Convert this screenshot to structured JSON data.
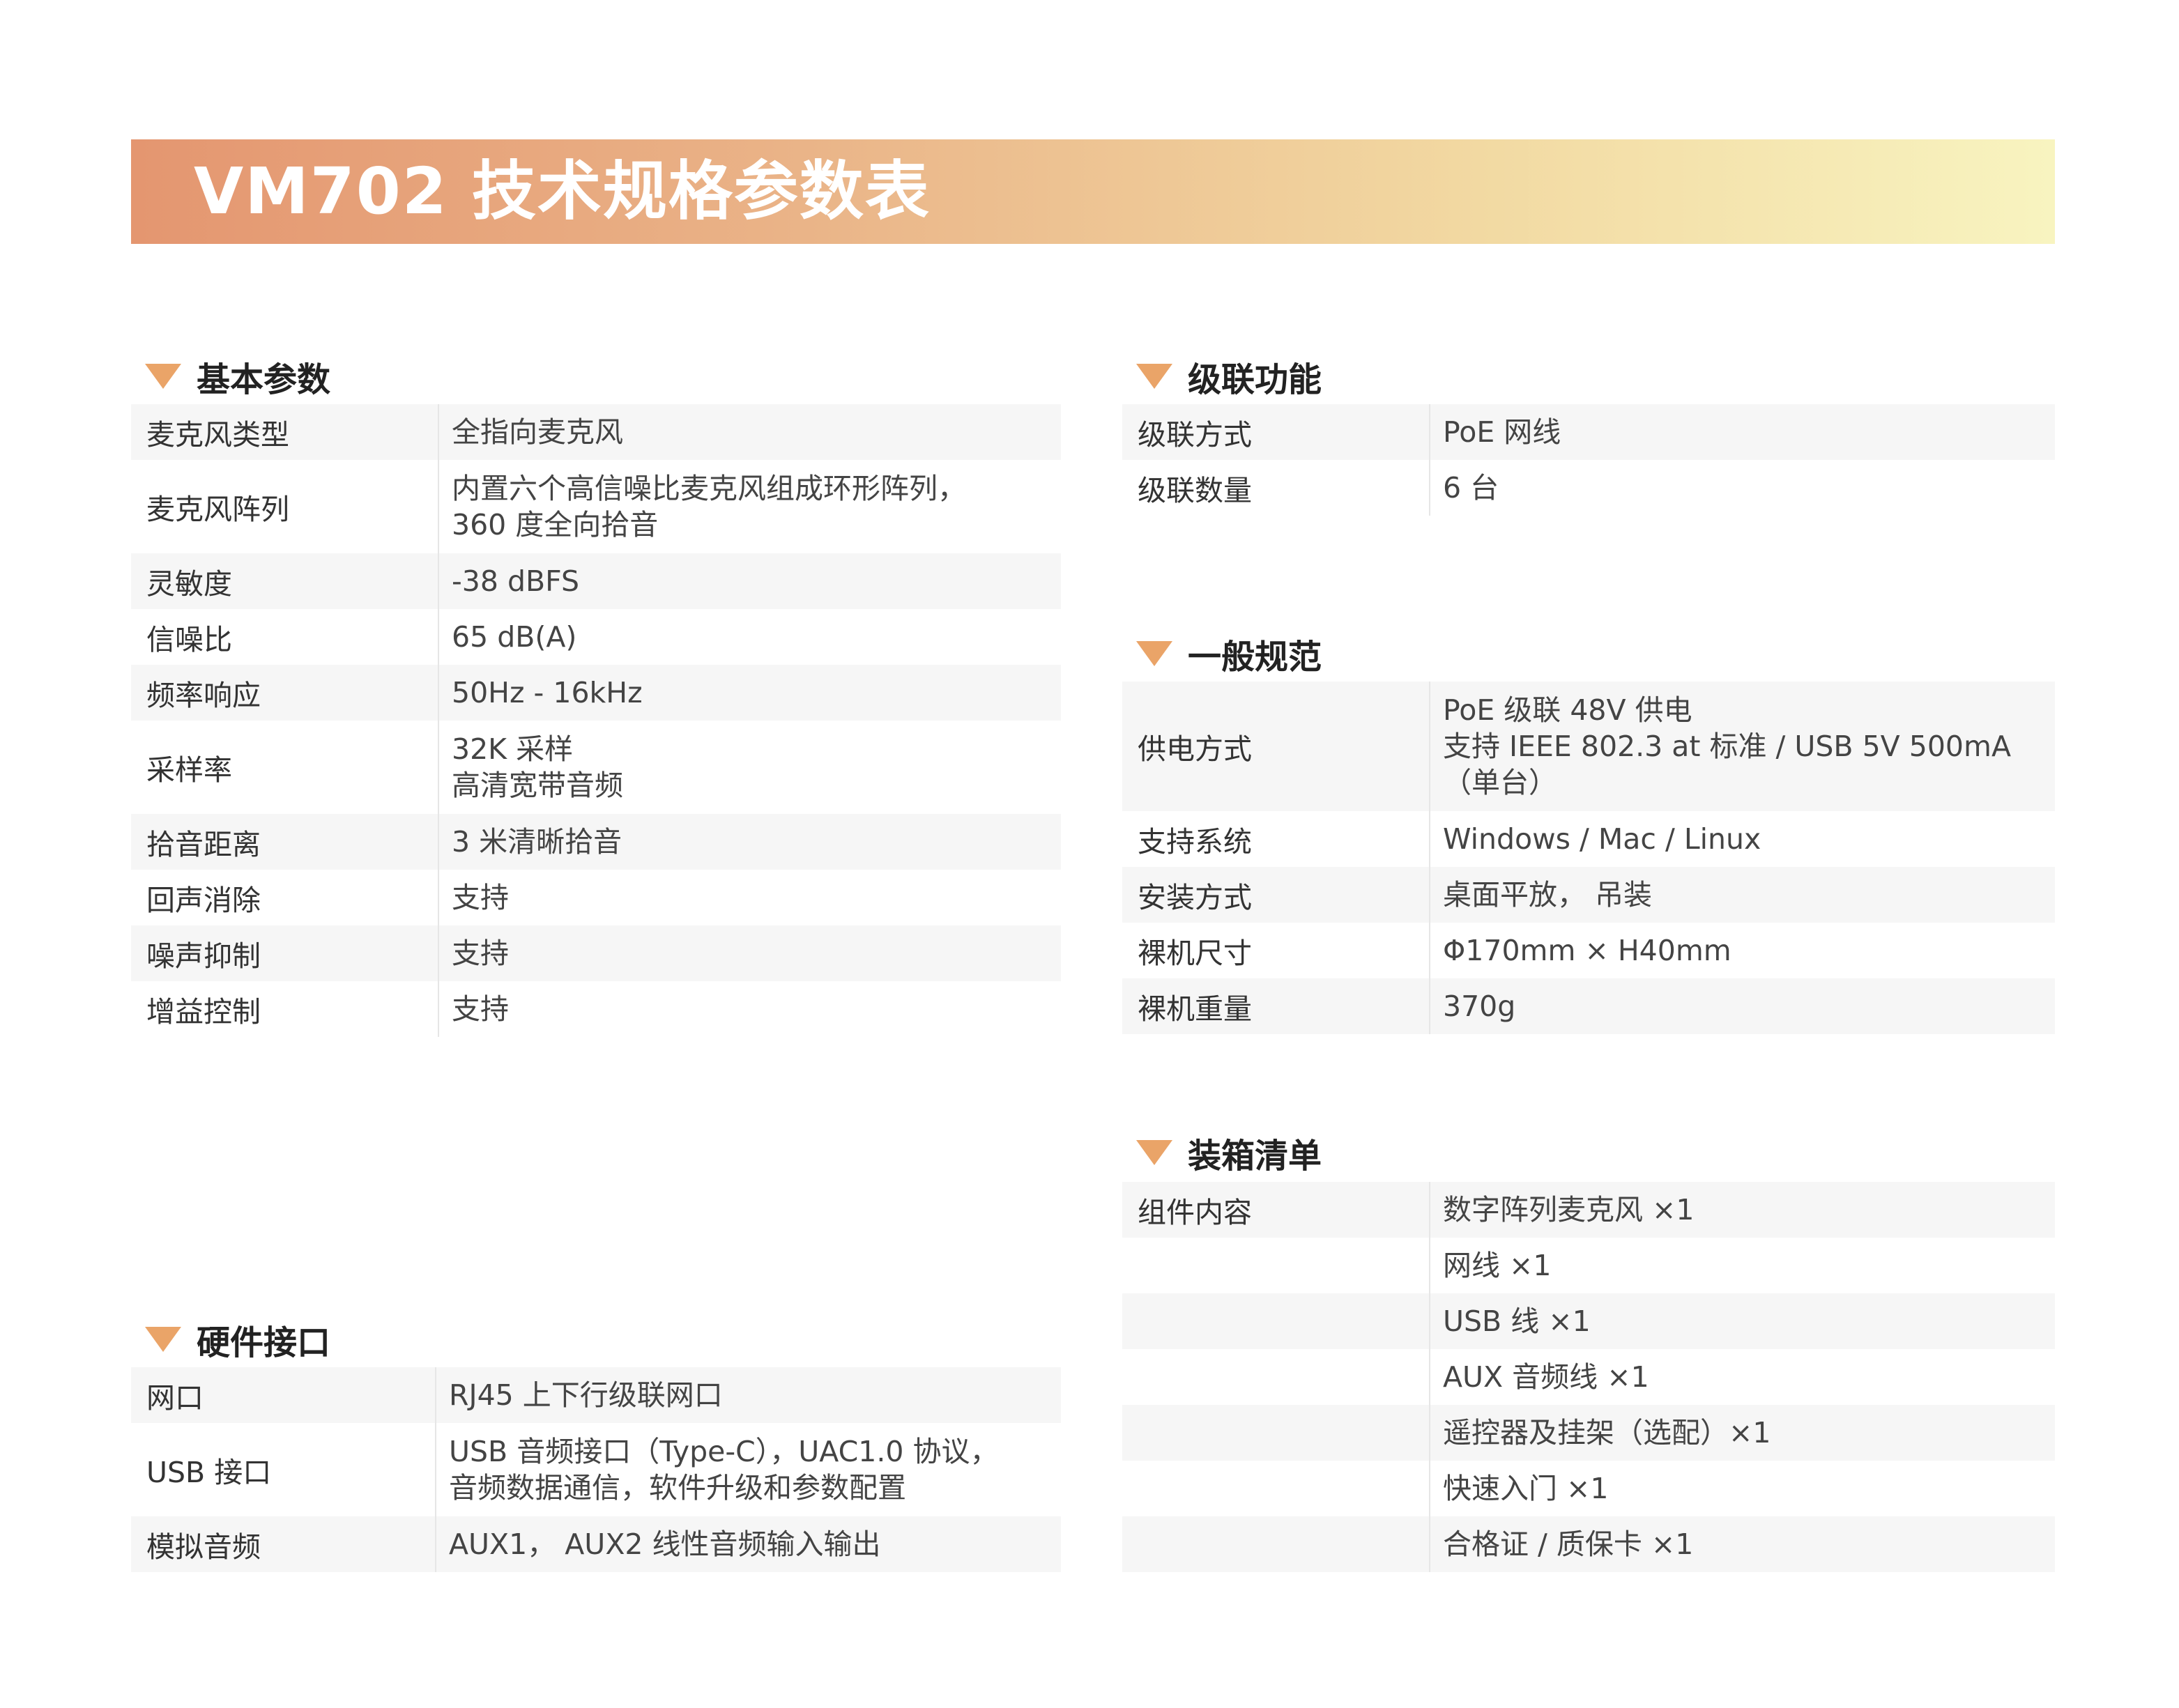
{
  "title": "VM702 技术规格参数表",
  "sections": {
    "basic": {
      "title": "基本参数",
      "rows": [
        {
          "label": "麦克风类型",
          "value": [
            "全指向麦克风"
          ]
        },
        {
          "label": "麦克风阵列",
          "value": [
            "内置六个高信噪比麦克风组成环形阵列，",
            "360 度全向拾音"
          ]
        },
        {
          "label": "灵敏度",
          "value": [
            "-38 dBFS"
          ]
        },
        {
          "label": "信噪比",
          "value": [
            "65 dB(A)"
          ]
        },
        {
          "label": "频率响应",
          "value": [
            "50Hz - 16kHz"
          ]
        },
        {
          "label": "采样率",
          "value": [
            "32K 采样",
            "高清宽带音频"
          ]
        },
        {
          "label": "拾音距离",
          "value": [
            "3 米清晰拾音"
          ]
        },
        {
          "label": "回声消除",
          "value": [
            "支持"
          ]
        },
        {
          "label": "噪声抑制",
          "value": [
            "支持"
          ]
        },
        {
          "label": "增益控制",
          "value": [
            "支持"
          ]
        }
      ]
    },
    "hardware": {
      "title": "硬件接口",
      "rows": [
        {
          "label": "网口",
          "value": [
            "RJ45 上下行级联网口"
          ]
        },
        {
          "label": "USB 接口",
          "value": [
            "USB 音频接口（Type-C），UAC1.0 协议，",
            "音频数据通信，软件升级和参数配置"
          ]
        },
        {
          "label": "模拟音频",
          "value": [
            "AUX1， AUX2 线性音频输入输出"
          ]
        }
      ]
    },
    "cascade": {
      "title": "级联功能",
      "rows": [
        {
          "label": "级联方式",
          "value": [
            "PoE 网线"
          ]
        },
        {
          "label": "级联数量",
          "value": [
            "6 台"
          ]
        }
      ]
    },
    "general": {
      "title": "一般规范",
      "rows": [
        {
          "label": "供电方式",
          "value": [
            "PoE 级联 48V 供电",
            "支持 IEEE 802.3 at 标准 / USB 5V 500mA",
            "（单台）"
          ]
        },
        {
          "label": "支持系统",
          "value": [
            "Windows / Mac / Linux"
          ]
        },
        {
          "label": "安装方式",
          "value": [
            "桌面平放， 吊装"
          ]
        },
        {
          "label": "裸机尺寸",
          "value": [
            "Φ170mm × H40mm"
          ]
        },
        {
          "label": "裸机重量",
          "value": [
            "370g"
          ]
        }
      ]
    },
    "packing": {
      "title": "装箱清单",
      "rows": [
        {
          "label": "组件内容",
          "value": [
            "数字阵列麦克风 ×1"
          ]
        },
        {
          "label": "",
          "value": [
            "网线 ×1"
          ]
        },
        {
          "label": "",
          "value": [
            "USB 线 ×1"
          ]
        },
        {
          "label": "",
          "value": [
            "AUX 音频线 ×1"
          ]
        },
        {
          "label": "",
          "value": [
            "遥控器及挂架（选配）×1"
          ]
        },
        {
          "label": "",
          "value": [
            "快速入门 ×1"
          ]
        },
        {
          "label": "",
          "value": [
            "合格证 / 质保卡 ×1"
          ]
        }
      ]
    }
  }
}
